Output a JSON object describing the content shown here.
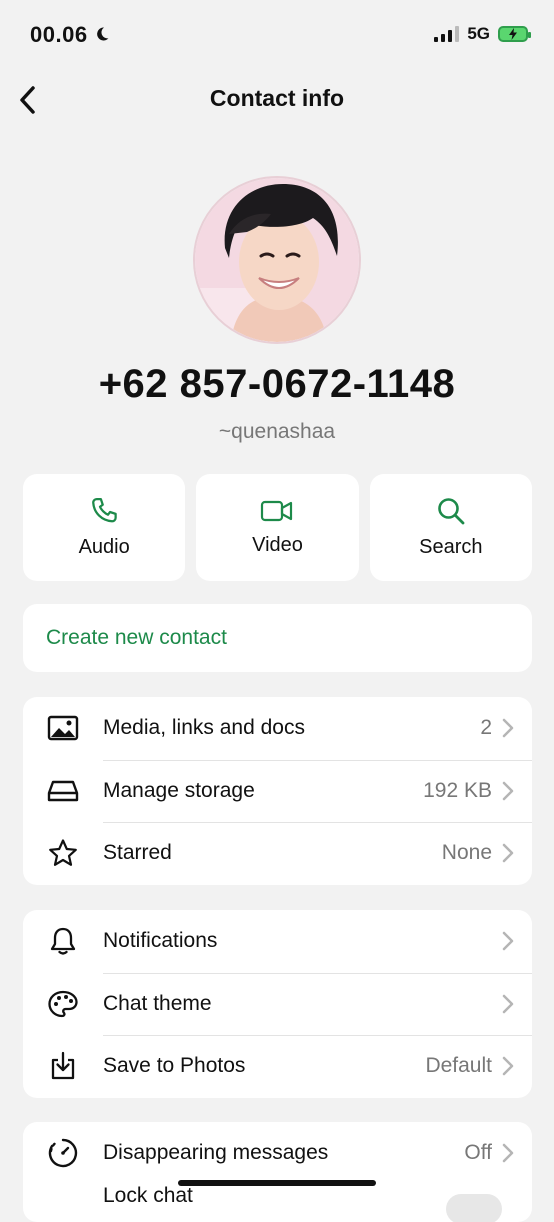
{
  "status_bar": {
    "time": "00.06",
    "network": "5G"
  },
  "header": {
    "title": "Contact info"
  },
  "profile": {
    "phone": "+62 857-0672-1148",
    "username": "~quenashaa"
  },
  "actions": [
    {
      "label": "Audio",
      "icon": "phone-icon"
    },
    {
      "label": "Video",
      "icon": "video-icon"
    },
    {
      "label": "Search",
      "icon": "search-icon"
    }
  ],
  "create_contact": {
    "label": "Create new contact"
  },
  "media_section": [
    {
      "label": "Media, links and docs",
      "value": "2",
      "icon": "image-icon"
    },
    {
      "label": "Manage storage",
      "value": "192 KB",
      "icon": "storage-icon"
    },
    {
      "label": "Starred",
      "value": "None",
      "icon": "star-icon"
    }
  ],
  "settings_section": [
    {
      "label": "Notifications",
      "value": "",
      "icon": "bell-icon"
    },
    {
      "label": "Chat theme",
      "value": "",
      "icon": "palette-icon"
    },
    {
      "label": "Save to Photos",
      "value": "Default",
      "icon": "download-icon"
    }
  ],
  "privacy_section": [
    {
      "label": "Disappearing messages",
      "value": "Off",
      "icon": "timer-icon"
    },
    {
      "label": "Lock chat",
      "value": "",
      "icon": "lock-icon"
    }
  ],
  "colors": {
    "accent": "#1d8a4a",
    "background": "#f2f2f2",
    "card": "#ffffff"
  }
}
